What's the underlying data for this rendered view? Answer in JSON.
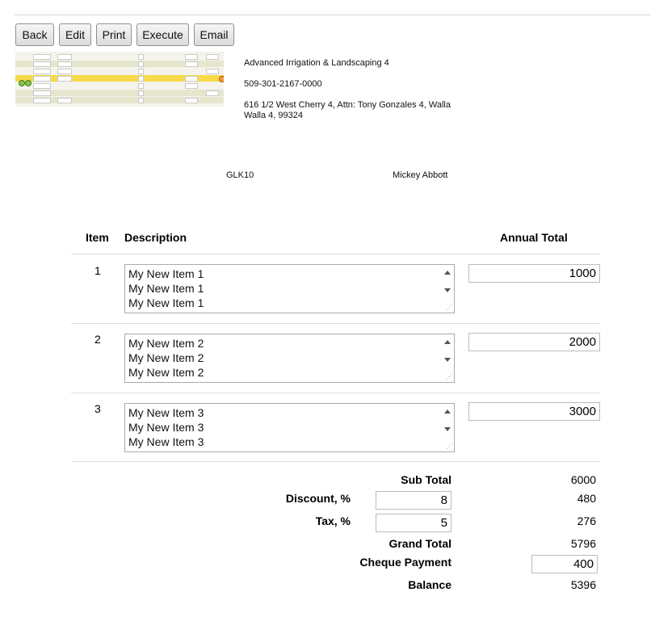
{
  "toolbar": {
    "back": "Back",
    "edit": "Edit",
    "print": "Print",
    "execute": "Execute",
    "email": "Email"
  },
  "company": {
    "name": "Advanced Irrigation & Landscaping 4",
    "phone": "509-301-2167-0000",
    "address": "616 1/2 West Cherry 4, Attn: Tony Gonzales 4, Walla Walla 4, 99324"
  },
  "meta": {
    "code": "GLK10",
    "person": "Mickey Abbott"
  },
  "table": {
    "headers": {
      "item": "Item",
      "description": "Description",
      "annual_total": "Annual Total"
    },
    "rows": [
      {
        "item": "1",
        "lines": [
          "My New Item 1",
          "My New Item 1",
          "My New Item 1"
        ],
        "total": "1000"
      },
      {
        "item": "2",
        "lines": [
          "My New Item 2",
          "My New Item 2",
          "My New Item 2"
        ],
        "total": "2000"
      },
      {
        "item": "3",
        "lines": [
          "My New Item 3",
          "My New Item 3",
          "My New Item 3"
        ],
        "total": "3000"
      }
    ]
  },
  "totals": {
    "sub_total_label": "Sub Total",
    "sub_total": "6000",
    "discount_label": "Discount, %",
    "discount_pct": "8",
    "discount_amount": "480",
    "tax_label": "Tax, %",
    "tax_pct": "5",
    "tax_amount": "276",
    "grand_total_label": "Grand Total",
    "grand_total": "5796",
    "cheque_label": "Cheque Payment",
    "cheque_payment": "400",
    "balance_label": "Balance",
    "balance": "5396"
  }
}
